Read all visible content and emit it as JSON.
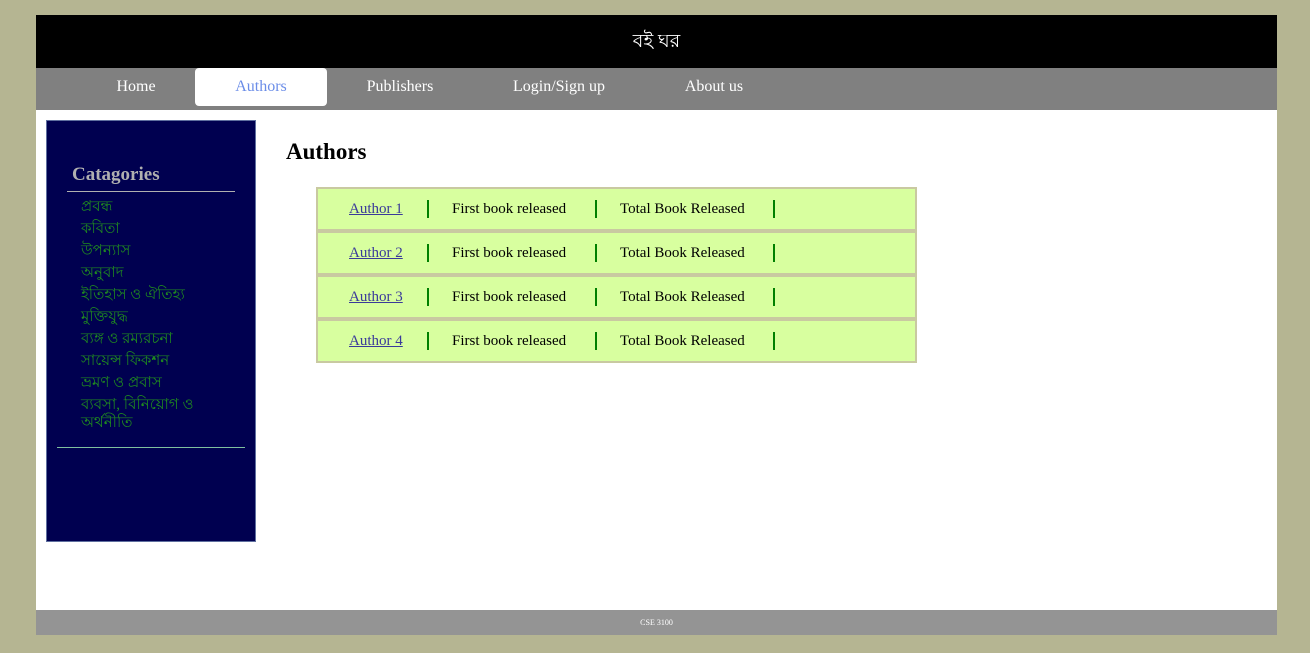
{
  "header": {
    "title": "বই ঘর"
  },
  "nav": {
    "items": [
      {
        "label": "Home"
      },
      {
        "label": "Authors"
      },
      {
        "label": "Publishers"
      },
      {
        "label": "Login/Sign up"
      },
      {
        "label": "About us"
      }
    ],
    "active": "Authors"
  },
  "sidebar": {
    "title": "Catagories",
    "categories": [
      "প্রবন্ধ",
      "কবিতা",
      "উপন্যাস",
      "অনুবাদ",
      "ইতিহাস ও ঐতিহ্য",
      "মুক্তিযুদ্ধ",
      "ব্যঙ্গ ও রম্যরচনা",
      "সায়েন্স ফিকশন",
      "ভ্রমণ ও প্রবাস",
      "ব্যবসা, বিনিয়োগ ও অর্থনীতি"
    ]
  },
  "main": {
    "title": "Authors",
    "rows": [
      {
        "author": "Author 1",
        "first_book": "First book released",
        "total_books": "Total Book Released"
      },
      {
        "author": "Author 2",
        "first_book": "First book released",
        "total_books": "Total Book Released"
      },
      {
        "author": "Author 3",
        "first_book": "First book released",
        "total_books": "Total Book Released"
      },
      {
        "author": "Author 4",
        "first_book": "First book released",
        "total_books": "Total Book Released"
      }
    ]
  },
  "footer": {
    "text": "CSE 3100"
  },
  "colors": {
    "page_bg": "#b5b592",
    "header_bg": "#000000",
    "nav_bg": "#808080",
    "nav_active_text": "#6b8de8",
    "sidebar_bg": "#000050",
    "category_text": "#1f8a1f",
    "row_bg": "#d8ff9f",
    "row_border": "#c9c9a1",
    "separator": "#008000",
    "footer_bg": "#949494"
  }
}
